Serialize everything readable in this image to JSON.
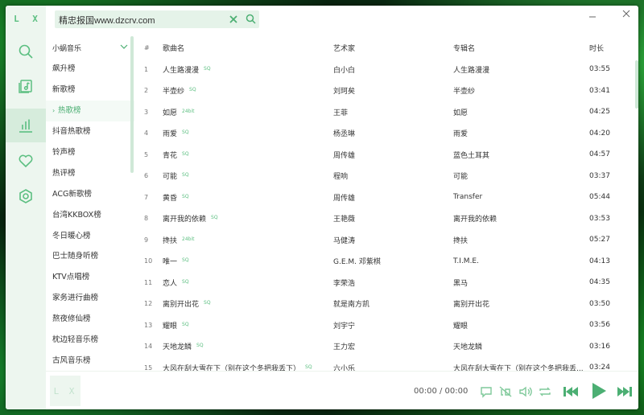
{
  "app": {
    "logo": "L X"
  },
  "search": {
    "query": "精忠报国www.dzcrv.com"
  },
  "list_panel": {
    "source": "小蜗音乐",
    "items": [
      {
        "label": "飙升榜"
      },
      {
        "label": "新歌榜"
      },
      {
        "label": "热歌榜",
        "active": true
      },
      {
        "label": "抖音热歌榜"
      },
      {
        "label": "铃声榜"
      },
      {
        "label": "热评榜"
      },
      {
        "label": "ACG新歌榜"
      },
      {
        "label": "台湾KKBOX榜"
      },
      {
        "label": "冬日暖心榜"
      },
      {
        "label": "巴士随身听榜"
      },
      {
        "label": "KTV点唱榜"
      },
      {
        "label": "家务进行曲榜"
      },
      {
        "label": "熬夜修仙榜"
      },
      {
        "label": "枕边轻音乐榜"
      },
      {
        "label": "古风音乐榜"
      }
    ]
  },
  "table": {
    "headers": {
      "num": "#",
      "name": "歌曲名",
      "artist": "艺术家",
      "album": "专辑名",
      "duration": "时长"
    },
    "rows": [
      {
        "num": "1",
        "name": "人生路漫漫",
        "quality": "SQ",
        "artist": "白小白",
        "album": "人生路漫漫",
        "duration": "03:55"
      },
      {
        "num": "2",
        "name": "半壶纱",
        "quality": "SQ",
        "artist": "刘珂矣",
        "album": "半壶纱",
        "duration": "03:41"
      },
      {
        "num": "3",
        "name": "如愿",
        "quality": "24bit",
        "artist": "王菲",
        "album": "如愿",
        "duration": "04:25"
      },
      {
        "num": "4",
        "name": "雨爱",
        "quality": "SQ",
        "artist": "杨丞琳",
        "album": "雨爱",
        "duration": "04:20"
      },
      {
        "num": "5",
        "name": "青花",
        "quality": "SQ",
        "artist": "周传雄",
        "album": "蓝色土耳其",
        "duration": "04:57"
      },
      {
        "num": "6",
        "name": "可能",
        "quality": "SQ",
        "artist": "程响",
        "album": "可能",
        "duration": "03:37"
      },
      {
        "num": "7",
        "name": "黄昏",
        "quality": "SQ",
        "artist": "周传雄",
        "album": "Transfer",
        "duration": "05:44"
      },
      {
        "num": "8",
        "name": "离开我的依赖",
        "quality": "SQ",
        "artist": "王艳薇",
        "album": "离开我的依赖",
        "duration": "03:53"
      },
      {
        "num": "9",
        "name": "搀扶",
        "quality": "24bit",
        "artist": "马健涛",
        "album": "搀扶",
        "duration": "05:27"
      },
      {
        "num": "10",
        "name": "唯一",
        "quality": "SQ",
        "artist": "G.E.M. 邓紫棋",
        "album": "T.I.M.E.",
        "duration": "04:13"
      },
      {
        "num": "11",
        "name": "恋人",
        "quality": "SQ",
        "artist": "李荣浩",
        "album": "黑马",
        "duration": "04:35"
      },
      {
        "num": "12",
        "name": "离别开出花",
        "quality": "SQ",
        "artist": "就是南方凯",
        "album": "离别开出花",
        "duration": "03:50"
      },
      {
        "num": "13",
        "name": "耀眼",
        "quality": "SQ",
        "artist": "刘宇宁",
        "album": "耀眼",
        "duration": "03:56"
      },
      {
        "num": "14",
        "name": "天地龙鳞",
        "quality": "SQ",
        "artist": "王力宏",
        "album": "天地龙鳞",
        "duration": "03:16"
      },
      {
        "num": "15",
        "name": "大风在刮大雪在下（别在这个冬把我丢下）",
        "quality": "SQ",
        "artist": "六小乐",
        "album": "大风在刮大雪在下（别在这个冬把我丢...",
        "duration": "03:24"
      }
    ]
  },
  "player": {
    "cover_text": "L X",
    "time": "00:00 / 00:00"
  },
  "colors": {
    "accent": "#5cbf81",
    "sidebar": "#edf6ef",
    "active": "#d6ecdc"
  }
}
